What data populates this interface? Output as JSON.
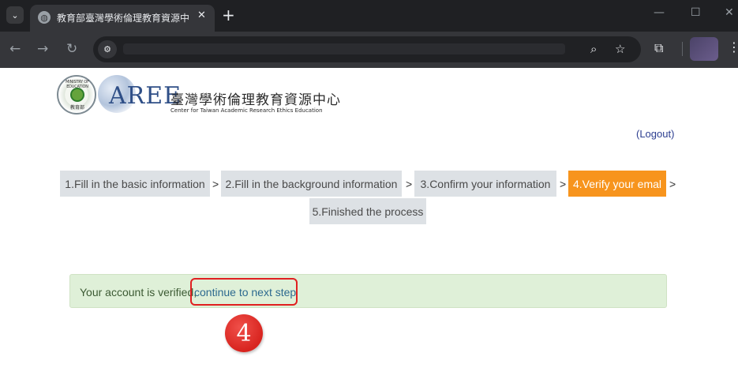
{
  "browser": {
    "tab_title": "教育部臺灣學術倫理教育資源中",
    "close_glyph": "✕",
    "new_tab_glyph": "+",
    "url": ""
  },
  "header": {
    "logo_moe_top": "MINISTRY OF EDUCATION",
    "logo_moe_bottom": "教育部",
    "logo_aree": "AREE",
    "org_name_zh": "臺灣學術倫理教育資源中心",
    "org_name_en": "Center for Taiwan Academic Research Ethics Education"
  },
  "logout_label": "(Logout)",
  "steps": [
    {
      "label": "1.Fill in the basic information",
      "active": false
    },
    {
      "label": "2.Fill in the background information",
      "active": false
    },
    {
      "label": "3.Confirm your information",
      "active": false
    },
    {
      "label": "4.Verify your emal",
      "active": true
    },
    {
      "label": "5.Finished the process",
      "active": false
    }
  ],
  "step_separator": ">",
  "alert": {
    "message": "Your account is verified,",
    "link_text": "continue to next step"
  },
  "annotation_marker": "4",
  "colors": {
    "active_step": "#f7941d",
    "alert_bg": "#dff0d8",
    "annotation": "#e02020"
  }
}
